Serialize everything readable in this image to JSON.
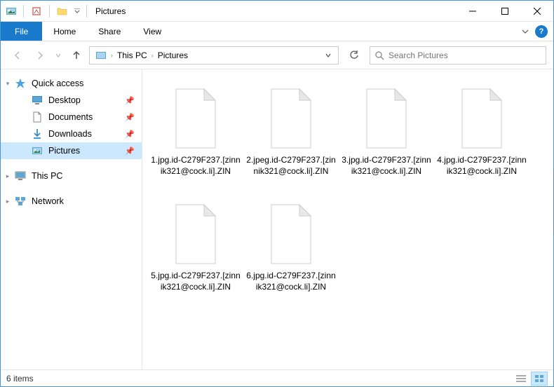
{
  "window": {
    "title": "Pictures"
  },
  "ribbon": {
    "file": "File",
    "tabs": [
      "Home",
      "Share",
      "View"
    ]
  },
  "breadcrumb": {
    "items": [
      "This PC",
      "Pictures"
    ]
  },
  "search": {
    "placeholder": "Search Pictures"
  },
  "sidebar": {
    "quick_access": "Quick access",
    "quick_items": [
      {
        "label": "Desktop",
        "pinned": true,
        "icon": "desktop"
      },
      {
        "label": "Documents",
        "pinned": true,
        "icon": "documents"
      },
      {
        "label": "Downloads",
        "pinned": true,
        "icon": "downloads"
      },
      {
        "label": "Pictures",
        "pinned": true,
        "icon": "pictures",
        "selected": true
      }
    ],
    "this_pc": "This PC",
    "network": "Network"
  },
  "files": [
    {
      "name": "1.jpg.id-C279F237.[zinnik321@cock.li].ZIN"
    },
    {
      "name": "2.jpeg.id-C279F237.[zinnik321@cock.li].ZIN"
    },
    {
      "name": "3.jpg.id-C279F237.[zinnik321@cock.li].ZIN"
    },
    {
      "name": "4.jpg.id-C279F237.[zinnik321@cock.li].ZIN"
    },
    {
      "name": "5.jpg.id-C279F237.[zinnik321@cock.li].ZIN"
    },
    {
      "name": "6.jpg.id-C279F237.[zinnik321@cock.li].ZIN"
    }
  ],
  "statusbar": {
    "count": "6 items"
  }
}
